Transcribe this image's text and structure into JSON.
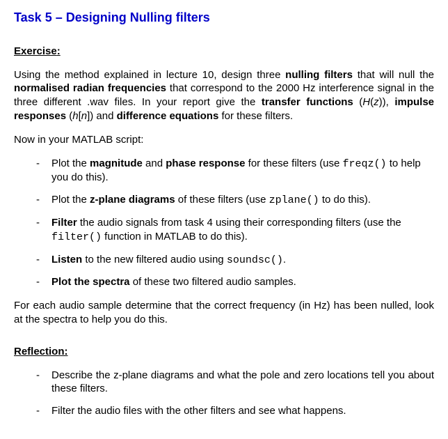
{
  "title": "Task 5 – Designing Nulling filters",
  "exercise_heading": "Exercise",
  "p1": {
    "t1": "Using the method explained in lecture 10, design three ",
    "b1": "nulling filters",
    "t2": " that will null the ",
    "b2": "normalised radian frequencies",
    "t3": " that correspond to the 2000 Hz interference signal in the three different .wav files. In your report give the ",
    "b3": "transfer functions",
    "t4": " (",
    "i1": "H",
    "t5": "(",
    "i2": "z",
    "t6": ")), ",
    "b4": "impulse responses",
    "t7": " (",
    "i3": "h",
    "t8": "[",
    "i4": "n",
    "t9": "]) and ",
    "b5": "difference equations",
    "t10": " for these filters."
  },
  "p2": "Now in your MATLAB script:",
  "list1": {
    "i1": {
      "t1": "Plot the ",
      "b1": "magnitude",
      "t2": " and ",
      "b2": "phase response",
      "t3": " for these filters (use ",
      "m1": "freqz()",
      "t4": " to help you do this)."
    },
    "i2": {
      "t1": "Plot the ",
      "b1": "z-plane diagrams",
      "t2": " of these filters (use ",
      "m1": "zplane()",
      "t3": " to do this)."
    },
    "i3": {
      "b1": "Filter",
      "t1": " the audio signals from task 4 using their corresponding filters (use the ",
      "m1": "filter()",
      "t2": " function in MATLAB to do this)."
    },
    "i4": {
      "b1": "Listen",
      "t1": " to the new filtered audio using ",
      "m1": "soundsc()",
      "t2": "."
    },
    "i5": {
      "b1": "Plot the spectra",
      "t1": " of these two filtered audio samples."
    }
  },
  "p3": "For each audio sample determine that the correct frequency (in Hz) has been nulled, look at the spectra to help you do this.",
  "reflection_heading": "Reflection",
  "list2": {
    "i1": "Describe the z-plane diagrams and what the pole and zero locations tell you about these filters.",
    "i2": "Filter the audio files with the other filters and see what happens."
  }
}
